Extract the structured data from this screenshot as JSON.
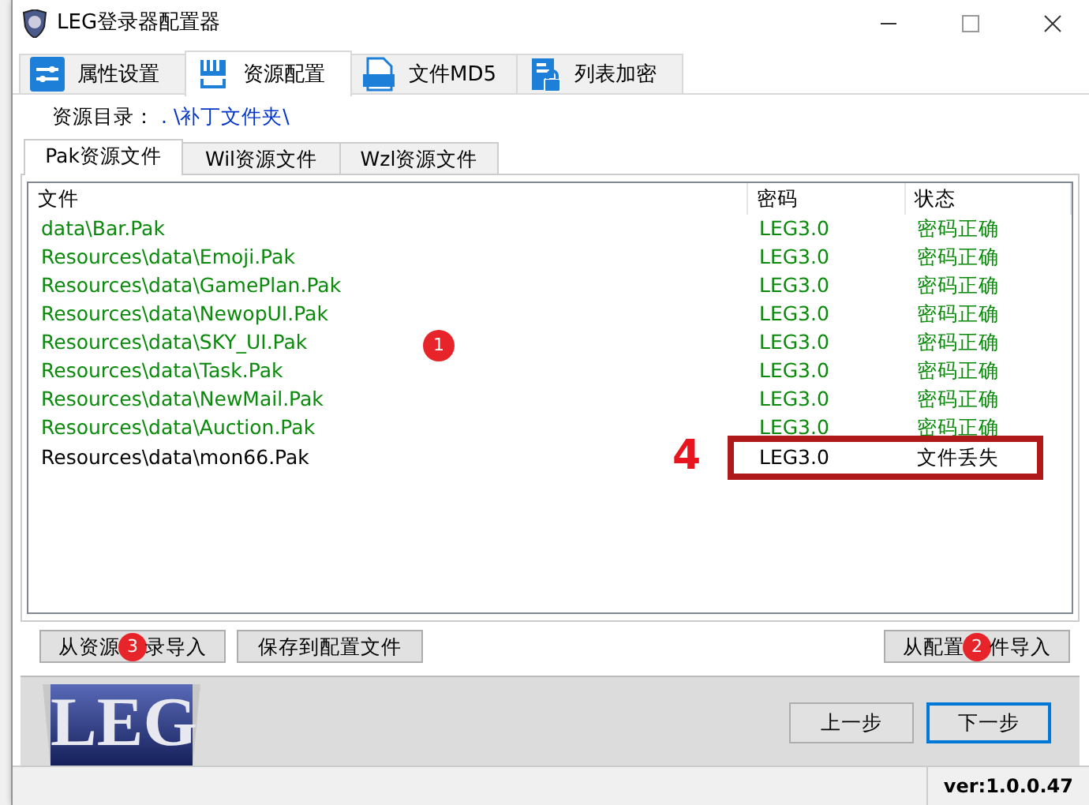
{
  "window": {
    "title": "LEG登录器配置器"
  },
  "tabs": [
    {
      "label": "属性设置",
      "selected": false
    },
    {
      "label": "资源配置",
      "selected": true
    },
    {
      "label": "文件MD5",
      "selected": false
    },
    {
      "label": "列表加密",
      "selected": false
    }
  ],
  "resource_dir": {
    "label": "资源目录：",
    "value": ". \\补丁文件夹\\"
  },
  "sub_tabs": [
    {
      "label": "Pak资源文件",
      "selected": true
    },
    {
      "label": "Wil资源文件",
      "selected": false
    },
    {
      "label": "Wzl资源文件",
      "selected": false
    }
  ],
  "table": {
    "columns": [
      "文件",
      "密码",
      "状态"
    ],
    "rows": [
      {
        "file": "data\\Bar.Pak",
        "password": "LEG3.0",
        "status": "密码正确",
        "missing": false,
        "highlighted": false
      },
      {
        "file": "Resources\\data\\Emoji.Pak",
        "password": "LEG3.0",
        "status": "密码正确",
        "missing": false,
        "highlighted": false
      },
      {
        "file": "Resources\\data\\GamePlan.Pak",
        "password": "LEG3.0",
        "status": "密码正确",
        "missing": false,
        "highlighted": false
      },
      {
        "file": "Resources\\data\\NewopUI.Pak",
        "password": "LEG3.0",
        "status": "密码正确",
        "missing": false,
        "highlighted": false
      },
      {
        "file": "Resources\\data\\SKY_UI.Pak",
        "password": "LEG3.0",
        "status": "密码正确",
        "missing": false,
        "highlighted": false
      },
      {
        "file": "Resources\\data\\Task.Pak",
        "password": "LEG3.0",
        "status": "密码正确",
        "missing": false,
        "highlighted": false
      },
      {
        "file": "Resources\\data\\NewMail.Pak",
        "password": "LEG3.0",
        "status": "密码正确",
        "missing": false,
        "highlighted": false
      },
      {
        "file": "Resources\\data\\Auction.Pak",
        "password": "LEG3.0",
        "status": "密码正确",
        "missing": false,
        "highlighted": false
      },
      {
        "file": "Resources\\data\\mon66.Pak",
        "password": "LEG3.0",
        "status": "文件丢失",
        "missing": true,
        "highlighted": true
      }
    ]
  },
  "panel_buttons": [
    {
      "label": "从资源",
      "badge": "3",
      "label_after": "录导入"
    },
    {
      "label": "保存到配置文件"
    },
    {
      "label": "从配置",
      "badge": "2",
      "label_after": "件导入"
    }
  ],
  "annotations": {
    "list_badge": "1",
    "highlight_label": "4"
  },
  "logo": {
    "text": "LEG"
  },
  "nav_buttons": [
    {
      "label": "上一步",
      "default": false
    },
    {
      "label": "下一步",
      "default": true
    }
  ],
  "status_bar": {
    "version": "ver:1.0.0.47"
  }
}
